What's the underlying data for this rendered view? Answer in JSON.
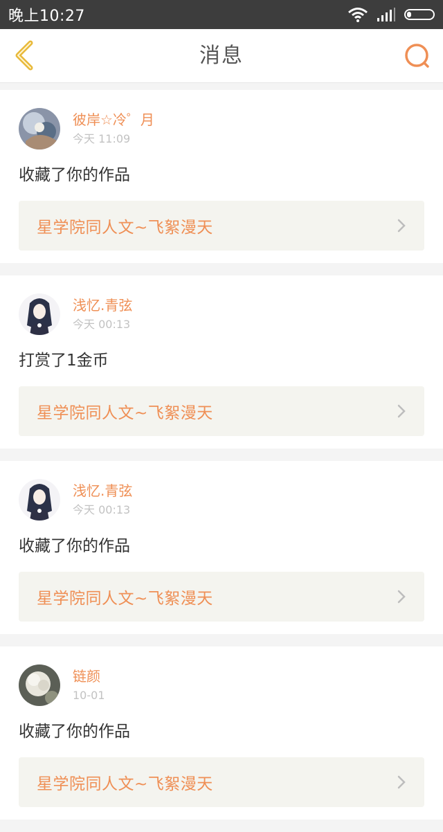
{
  "status_bar": {
    "time": "晚上10:27"
  },
  "header": {
    "title": "消息"
  },
  "messages": [
    {
      "username": "彼岸☆冷゜月",
      "time": "今天 11:09",
      "action": "收藏了你的作品",
      "work_title": "星学院同人文~飞絮漫天",
      "avatar": "avatar-1"
    },
    {
      "username": "浅忆.青弦",
      "time": "今天 00:13",
      "action": "打赏了1金币",
      "work_title": "星学院同人文~飞絮漫天",
      "avatar": "avatar-2"
    },
    {
      "username": "浅忆.青弦",
      "time": "今天 00:13",
      "action": "收藏了你的作品",
      "work_title": "星学院同人文~飞絮漫天",
      "avatar": "avatar-2"
    },
    {
      "username": "链颜",
      "time": "10-01",
      "action": "收藏了你的作品",
      "work_title": "星学院同人文~飞絮漫天",
      "avatar": "avatar-3"
    }
  ],
  "colors": {
    "accent": "#ef8f55",
    "back_icon": "#e8b93a",
    "status_bar": "#3d3d3d"
  },
  "icons": {
    "back": "chevron-left-icon",
    "search": "search-icon",
    "chevron": "chevron-right-icon"
  }
}
